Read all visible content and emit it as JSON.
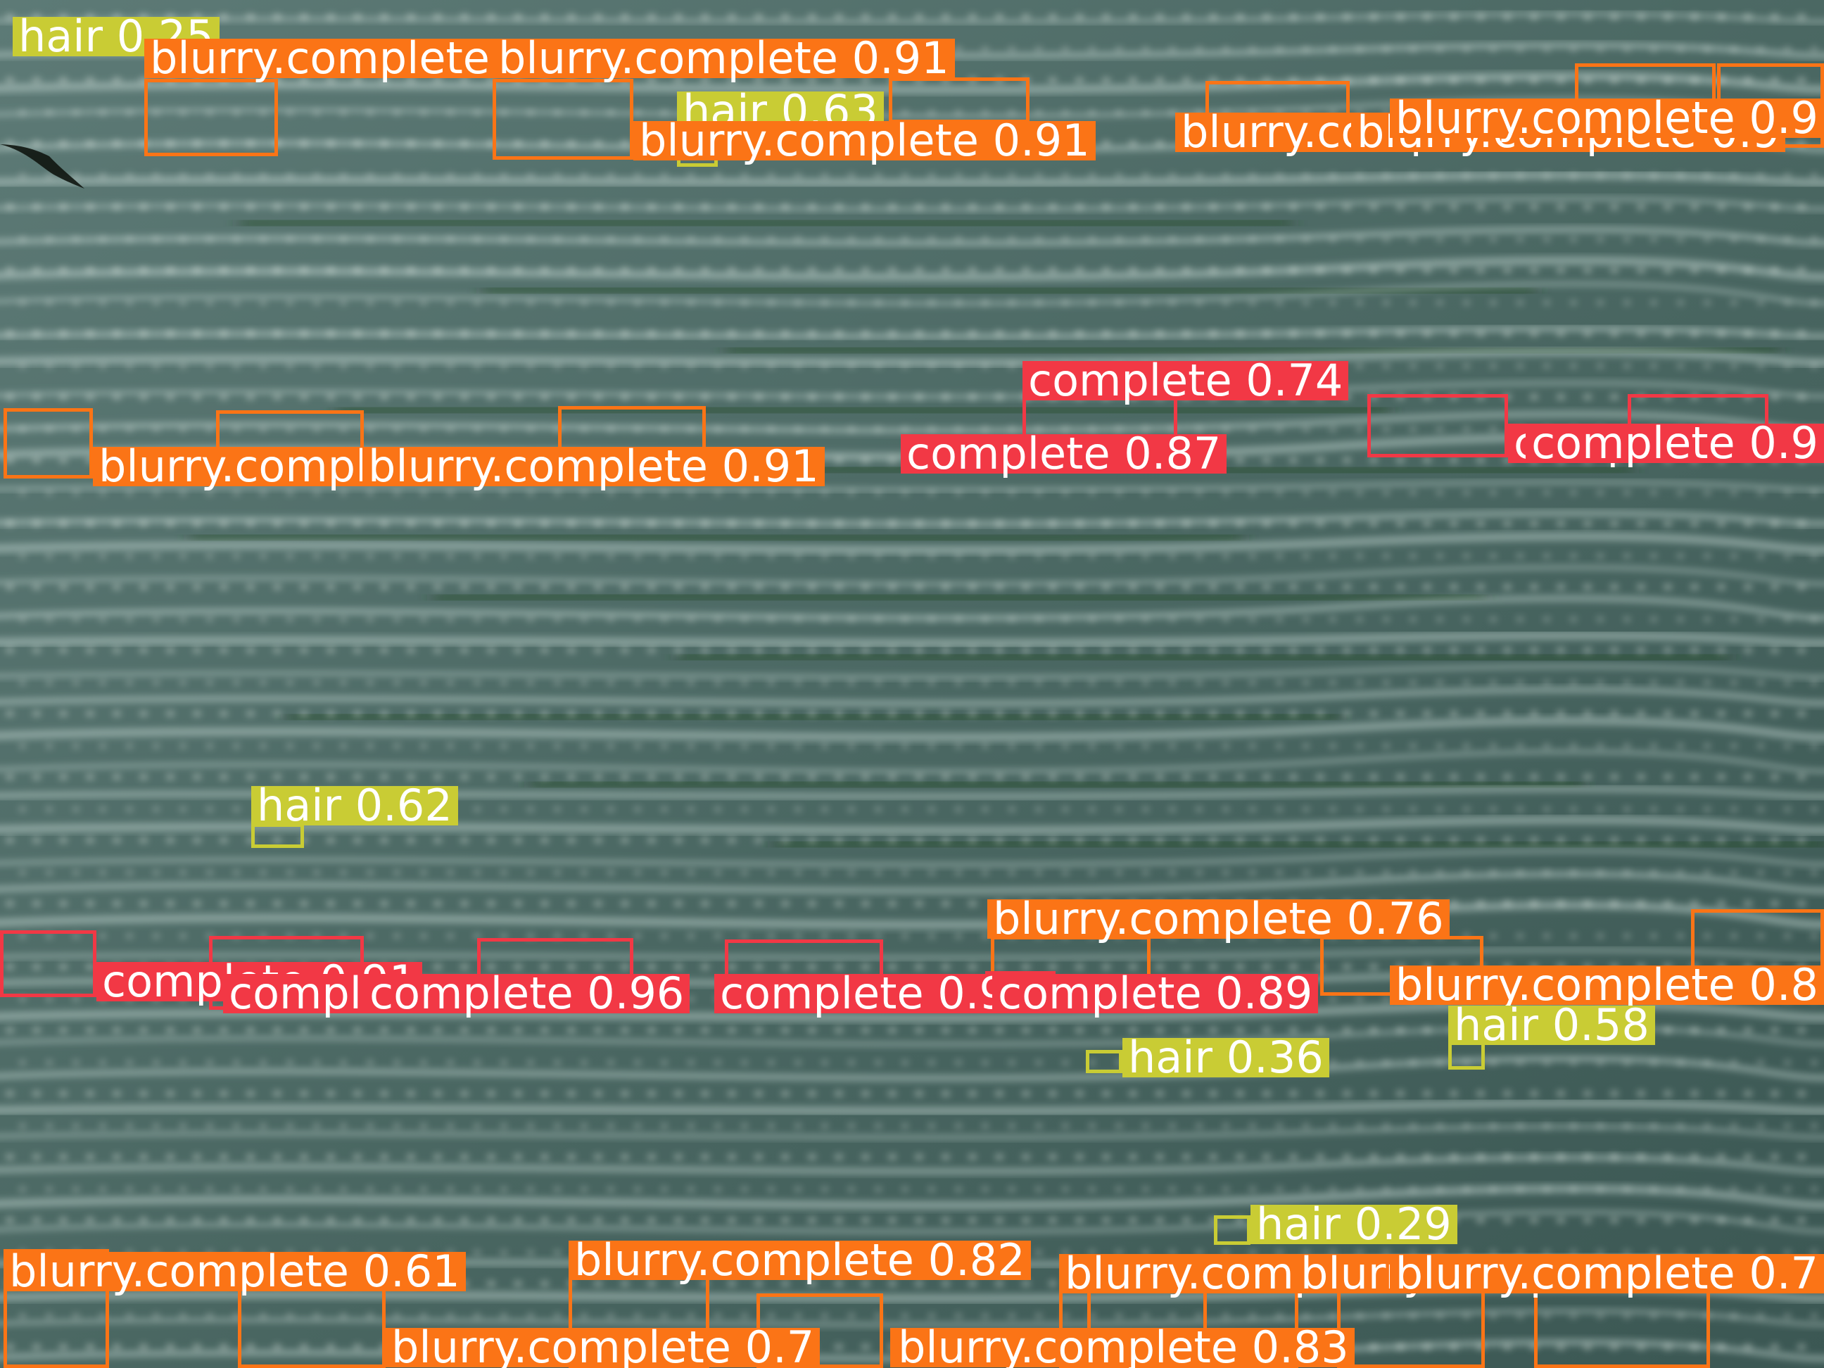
{
  "image": {
    "subject": "micrograph of leaf epidermis with stomata, object-detection overlay",
    "class_colors": {
      "complete": "#f23845",
      "blurry.complete": "#fb7416",
      "hair": "#c9cc34"
    }
  },
  "detections": [
    {
      "class": "hair",
      "score": "0.25"
    },
    {
      "class": "blurry.complete",
      "score": "0.91"
    },
    {
      "class": "blurry.complete",
      "score": "0.91"
    },
    {
      "class": "hair",
      "score": "0.63"
    },
    {
      "class": "blurry.complete",
      "score": "0.91"
    },
    {
      "class": "blurry.complete",
      "score": "0.9"
    },
    {
      "class": "blurry.complete",
      "score": "0.9"
    },
    {
      "class": "blurry.complete",
      "score": "0.9"
    },
    {
      "class": "complete",
      "score": "0.74"
    },
    {
      "class": "complete",
      "score": "0.9"
    },
    {
      "class": "complete",
      "score": "0.9"
    },
    {
      "class": "blurry.complete",
      "score": "0.8"
    },
    {
      "class": "blurry.complete",
      "score": "0.8"
    },
    {
      "class": "blurry.complete",
      "score": "0.91"
    },
    {
      "class": "complete",
      "score": "0.87"
    },
    {
      "class": "hair",
      "score": "0.62"
    },
    {
      "class": "complete",
      "score": "0.91"
    },
    {
      "class": "complete",
      "score": "0.8"
    },
    {
      "class": "complete",
      "score": "0.96"
    },
    {
      "class": "complete",
      "score": "0.95"
    },
    {
      "class": "blurry.complete",
      "score": "0.76"
    },
    {
      "class": "complete",
      "score": "0.89"
    },
    {
      "class": "blurry.complete",
      "score": "0.8"
    },
    {
      "class": "blurry.complete",
      "score": "0.8"
    },
    {
      "class": "hair",
      "score": "0.58"
    },
    {
      "class": "hair",
      "score": "0.36"
    },
    {
      "class": "hair",
      "score": "0.29"
    },
    {
      "class": "blurry.complete",
      "score": "0.61"
    },
    {
      "class": "blurry.complete",
      "score": "0.7"
    },
    {
      "class": "blurry.complete",
      "score": "0.82"
    },
    {
      "class": "blurry.complete",
      "score": "0.7"
    },
    {
      "class": "blurry.complete",
      "score": "0.83"
    },
    {
      "class": "blurry.complete",
      "score": "0.8"
    },
    {
      "class": "blurry.complete",
      "score": "0.8"
    },
    {
      "class": "blurry.complete",
      "score": "0.7"
    }
  ]
}
